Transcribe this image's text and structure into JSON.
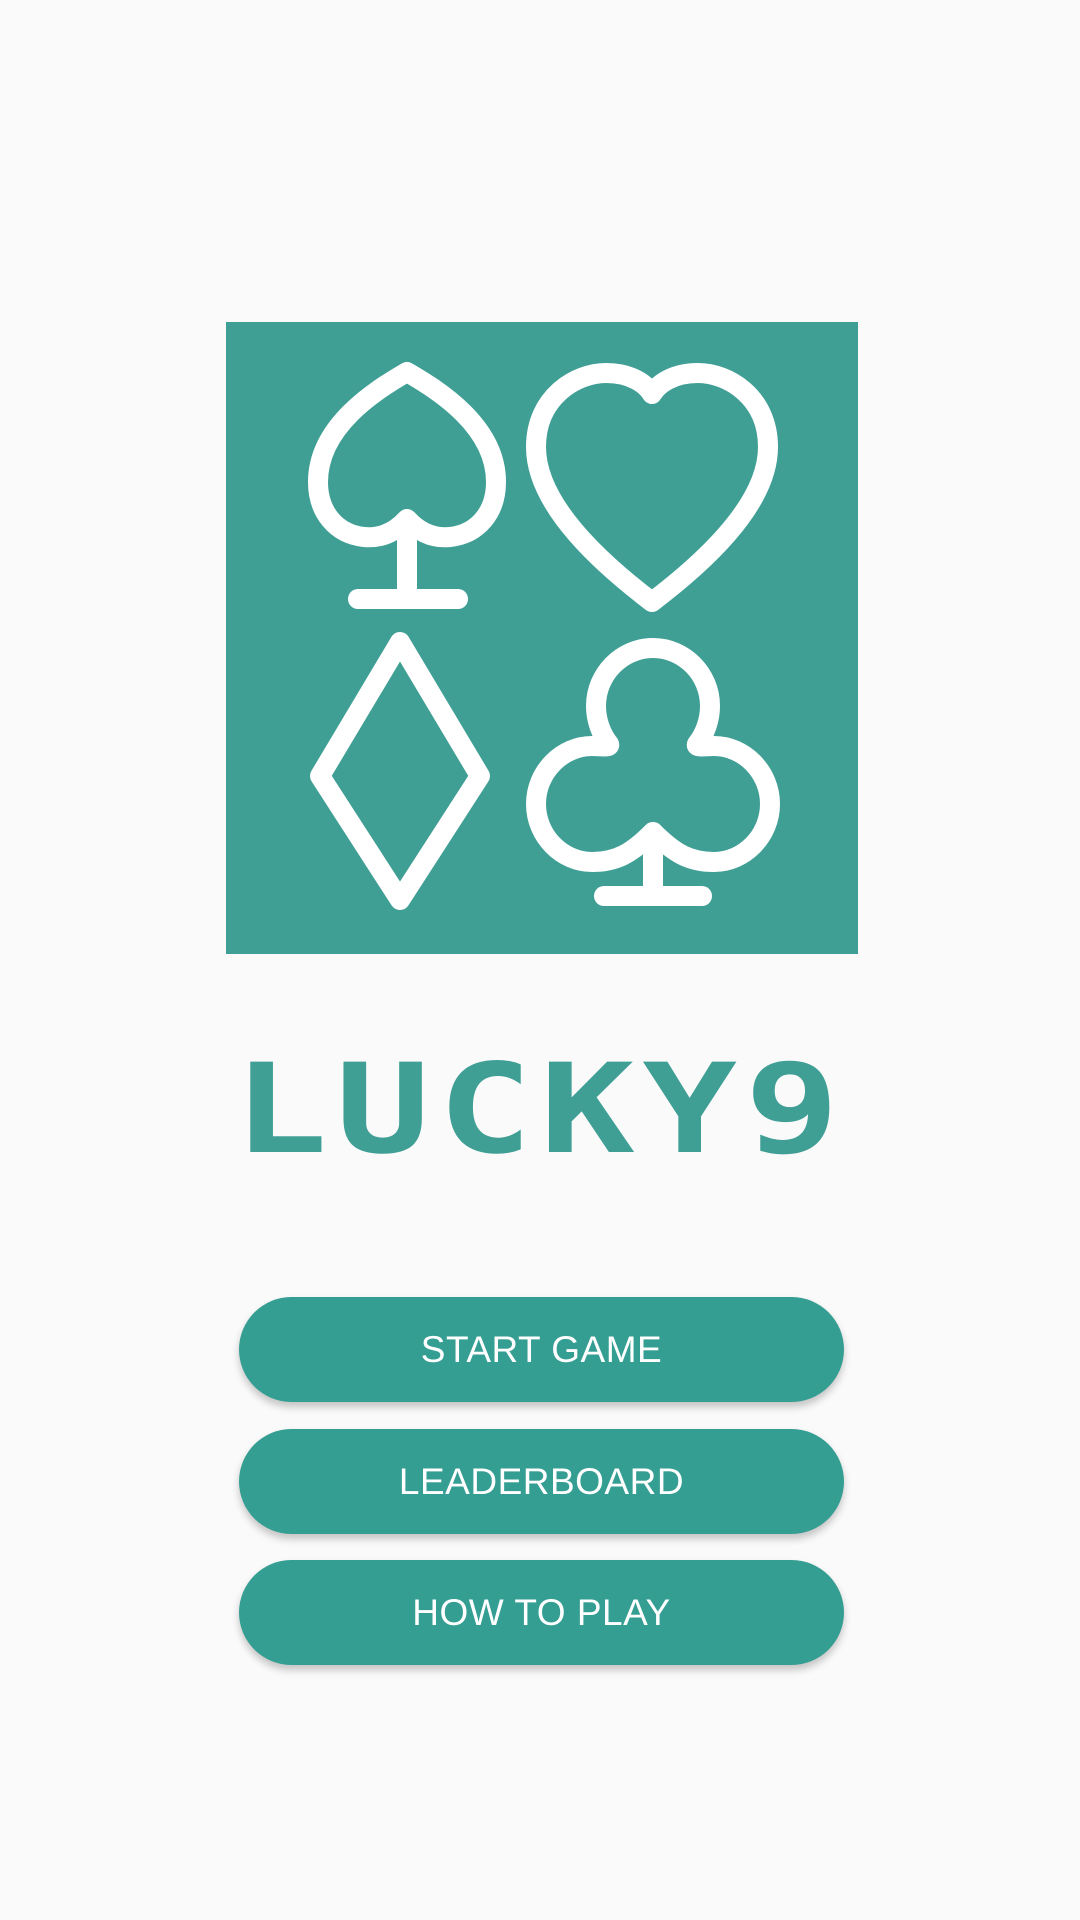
{
  "app": {
    "title": "LUCKY9"
  },
  "logo": {
    "icons": [
      "spade-icon",
      "heart-icon",
      "diamond-icon",
      "club-icon"
    ],
    "background_color": "#409f95",
    "stroke_color": "#ffffff"
  },
  "menu": {
    "start_label": "START GAME",
    "leaderboard_label": "LEADERBOARD",
    "how_to_play_label": "HOW TO PLAY"
  },
  "colors": {
    "background": "#fafafa",
    "accent": "#359e93",
    "title": "#409f95",
    "button_text": "#ffffff"
  }
}
